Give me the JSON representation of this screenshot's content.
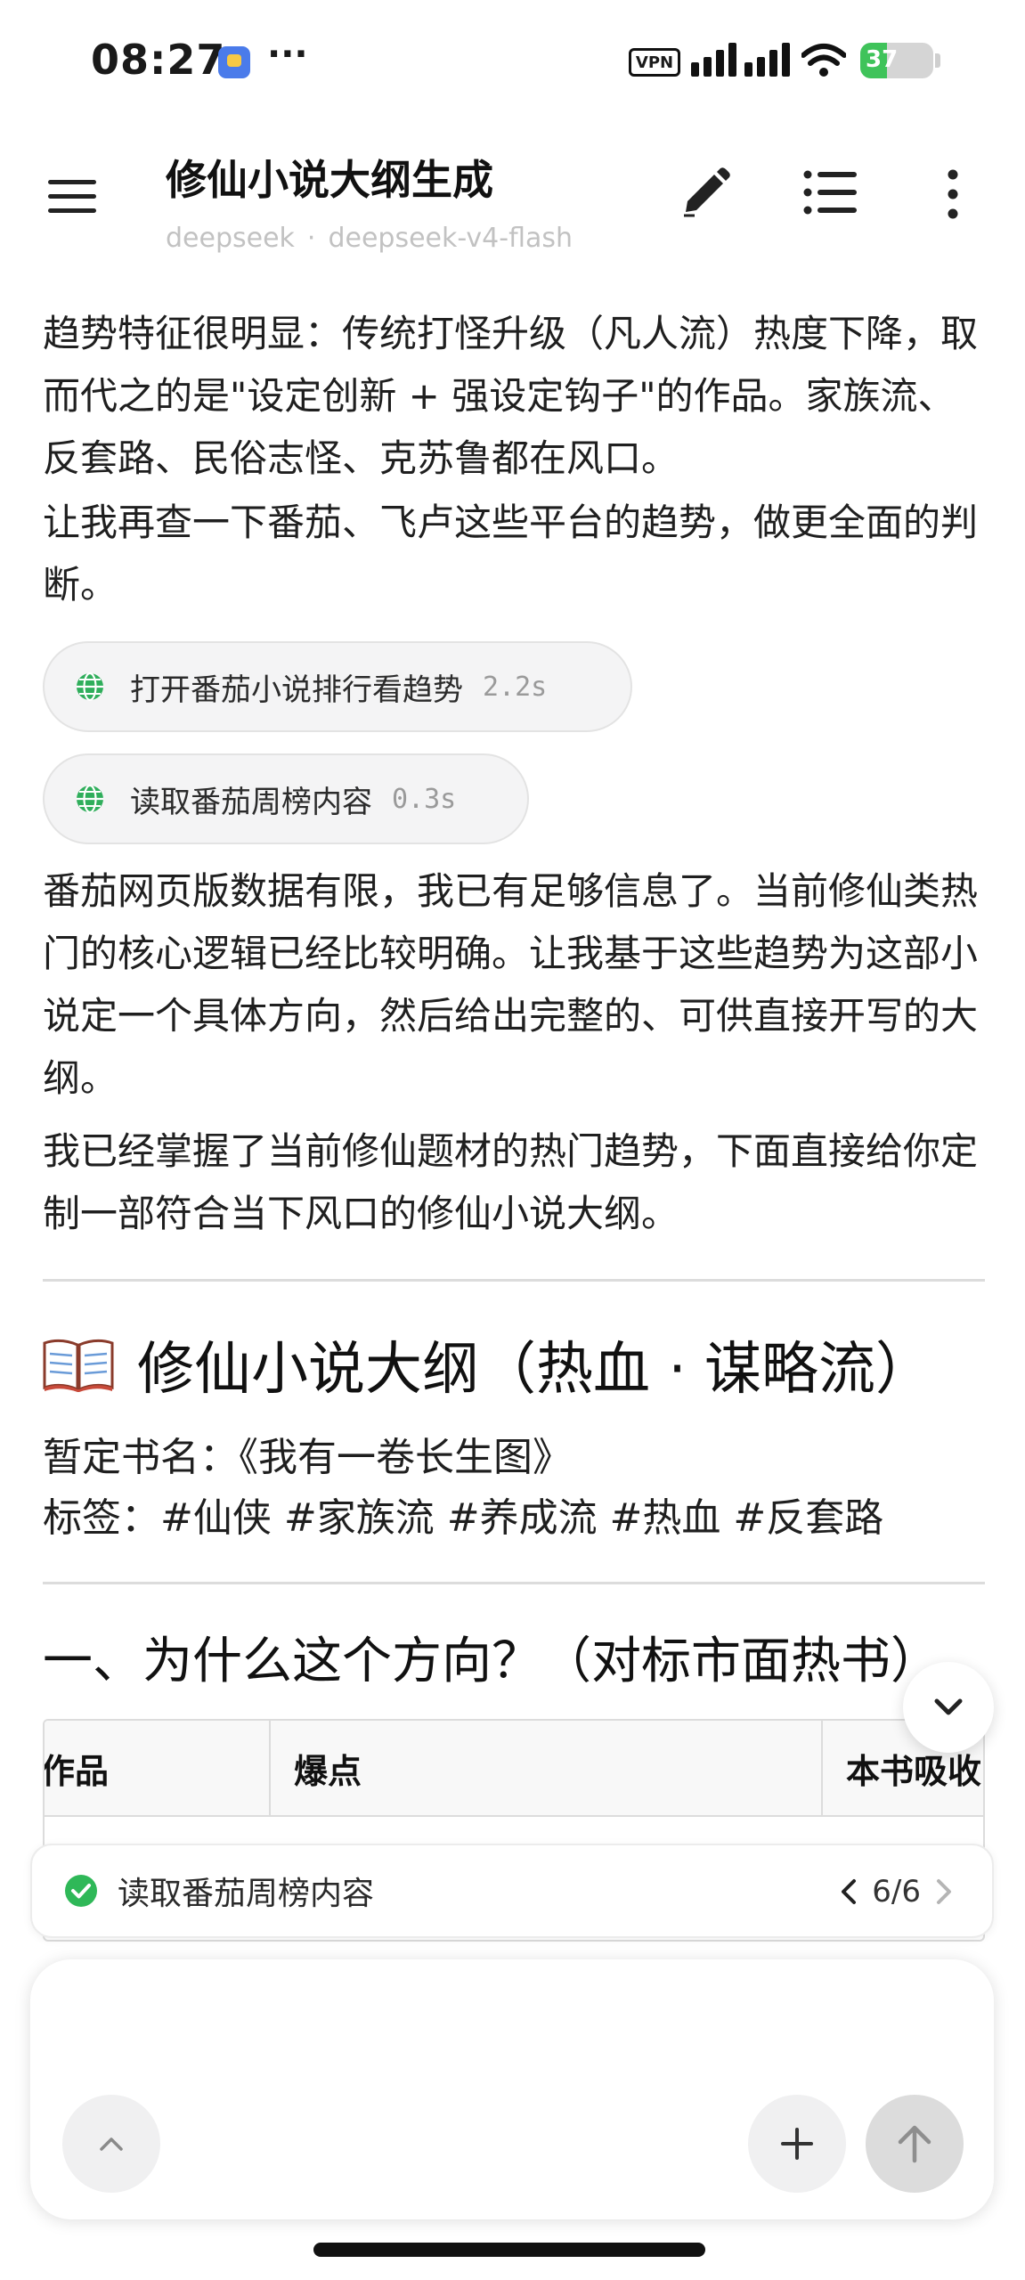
{
  "status_bar": {
    "time": "08:27",
    "overflow_dots": "···",
    "vpn_label": "VPN",
    "battery_level": "37",
    "battery_fraction": 0.37
  },
  "header": {
    "title": "修仙小说大纲生成",
    "provider": "deepseek",
    "separator": "·",
    "model": "deepseek-v4-flash"
  },
  "messages": {
    "para1": "趋势特征很明显：传统打怪升级（凡人流）热度下降，取而代之的是\"设定创新 + 强设定钩子\"的作品。家族流、反套路、民俗志怪、克苏鲁都在风口。",
    "para2": "让我再查一下番茄、飞卢这些平台的趋势，做更全面的判断。",
    "tool_calls": [
      {
        "label": "打开番茄小说排行看趋势",
        "duration": "2.2s"
      },
      {
        "label": "读取番茄周榜内容",
        "duration": "0.3s"
      }
    ],
    "para3": "番茄网页版数据有限，我已有足够信息了。当前修仙类热门的核心逻辑已经比较明确。让我基于这些趋势为这部小说定一个具体方向，然后给出完整的、可供直接开写的大纲。",
    "para4": "我已经掌握了当前修仙题材的热门趋势，下面直接给你定制一部符合当下风口的修仙小说大纲。"
  },
  "outline": {
    "heading": "修仙小说大纲（热血 · 谋略流）",
    "book_title": "暂定书名：《我有一卷长生图》",
    "tags": "标签：#仙侠 #家族流 #养成流 #热血 #反套路",
    "section_heading": "一、为什么这个方向？（对标市面热书）",
    "table_headers": [
      "作品",
      "爆点",
      "本书吸收"
    ]
  },
  "progress": {
    "label": "读取番茄周榜内容",
    "pager": "6/6"
  },
  "composer": {
    "placeholder": ""
  }
}
